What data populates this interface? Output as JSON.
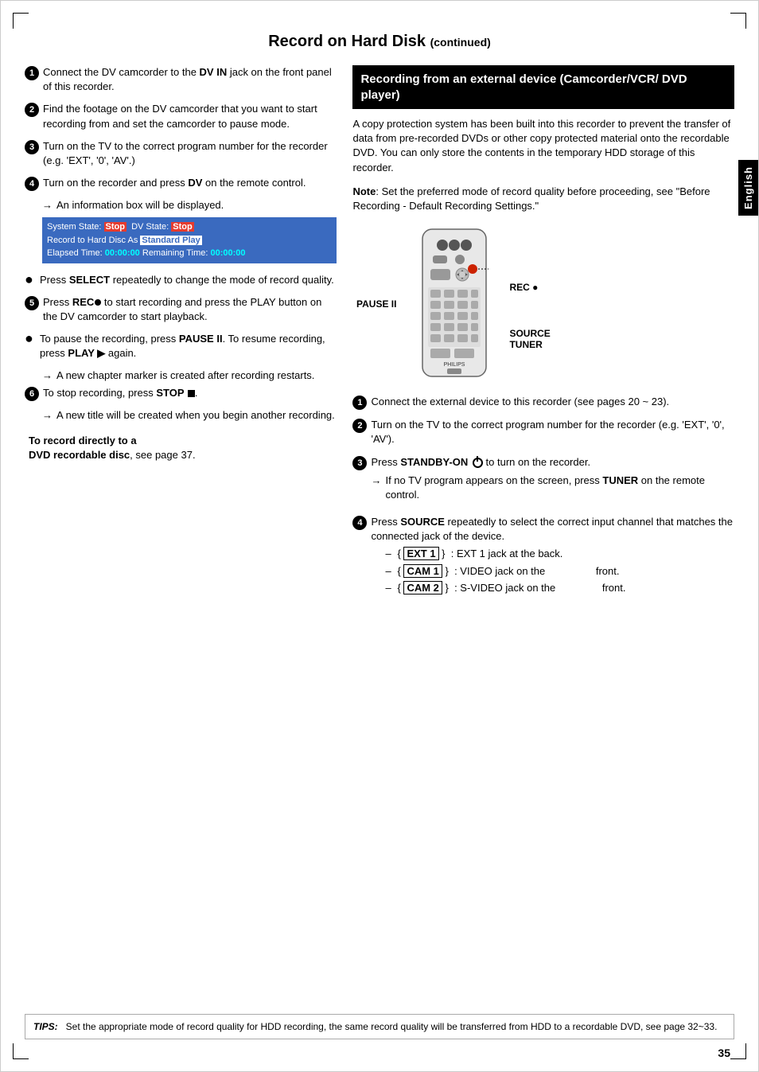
{
  "page": {
    "title": "Record on Hard Disk",
    "title_continued": "(continued)",
    "page_number": "35",
    "english_tab": "English"
  },
  "tips": {
    "label": "TIPS:",
    "text": "Set the appropriate mode of record quality for HDD recording, the same record quality will be transferred from HDD to a recordable DVD, see page 32~33."
  },
  "left_column": {
    "steps": [
      {
        "num": "1",
        "type": "circle-filled",
        "html": "Connect the DV camcorder to the <b>DV IN</b> jack on the front panel of this recorder."
      },
      {
        "num": "2",
        "type": "circle-filled",
        "html": "Find the footage on the DV camcorder that you want to start recording from and set the camcorder to pause mode."
      },
      {
        "num": "3",
        "type": "circle-filled",
        "html": "Turn on the TV to the correct program number for the recorder (e.g. 'EXT', '0', 'AV'.)"
      },
      {
        "num": "4",
        "type": "circle-filled",
        "html": "Turn on the recorder and press <b>DV</b> on the remote control."
      }
    ],
    "arrow_4": "An information box will be displayed.",
    "info_box": {
      "line1_pre": "System State: ",
      "stop1": "Stop",
      "line1_mid": "  DV State: ",
      "stop2": "Stop",
      "line2_pre": "Record to Hard Disc As ",
      "standard": "Standard Play",
      "line3_pre": "Elapsed Time: ",
      "time1": "00:00:00",
      "line3_mid": " Remaining Time: ",
      "time2": "00:00:00"
    },
    "bullet1": {
      "text_pre": "Press ",
      "bold": "SELECT",
      "text_post": " repeatedly to change the mode of record quality."
    },
    "step5": {
      "num": "5",
      "text_pre": "Press ",
      "bold": "REC",
      "text_post": " to start recording and press the PLAY button on the DV camcorder to start playback."
    },
    "bullet2": {
      "text": "To pause the recording, press <b>PAUSE II</b>. To resume recording, press <b>PLAY ▶</b> again."
    },
    "arrow_bullet2": "A new chapter marker is created after recording restarts.",
    "step6": {
      "num": "6",
      "text": "To stop recording, press <b>STOP ■</b>."
    },
    "arrow_step6": "A new title will be created when you begin another recording.",
    "dvd_note": {
      "bold1": "To record directly to a",
      "bold2": "DVD recordable disc",
      "text": ", see page 37."
    }
  },
  "right_column": {
    "section_header": "Recording from an external device (Camcorder/VCR/ DVD player)",
    "copy_protection_text": "A copy protection system has been built into this recorder to prevent the transfer of data from pre-recorded DVDs or other copy protected material onto the recordable DVD. You can only store the contents in the temporary HDD storage of this recorder.",
    "note": {
      "label": "Note",
      "text": ": Set the preferred mode of record quality before proceeding, see \"Before Recording - Default Recording Settings.\""
    },
    "remote": {
      "pause_label": "PAUSE II",
      "rec_label": "REC ●",
      "source_label": "SOURCE",
      "tuner_label": "TUNER"
    },
    "steps": [
      {
        "num": "1",
        "type": "circle-filled",
        "text": "Connect the external device to this recorder (see pages 20 ~ 23)."
      },
      {
        "num": "2",
        "type": "circle-filled",
        "text": "Turn on the TV to the correct program number for the recorder (e.g. 'EXT', '0', 'AV')."
      },
      {
        "num": "3",
        "type": "circle-filled",
        "text_pre": "Press ",
        "bold": "STANDBY-ON",
        "text_post": " to turn on the recorder.",
        "arrow": "If no TV program appears on the screen, press <b>TUNER</b> on the remote control."
      },
      {
        "num": "4",
        "type": "circle-filled",
        "text_pre": "Press ",
        "bold": "SOURCE",
        "text_post": " repeatedly to select the correct input channel that matches the connected jack of the device.",
        "dashes": [
          {
            "code": "EXT 1",
            "text": ": EXT 1 jack at the back."
          },
          {
            "code": "CAM 1",
            "text": ": VIDEO jack on the front."
          },
          {
            "code": "CAM 2",
            "text": ": S-VIDEO jack on the front."
          }
        ]
      }
    ]
  }
}
